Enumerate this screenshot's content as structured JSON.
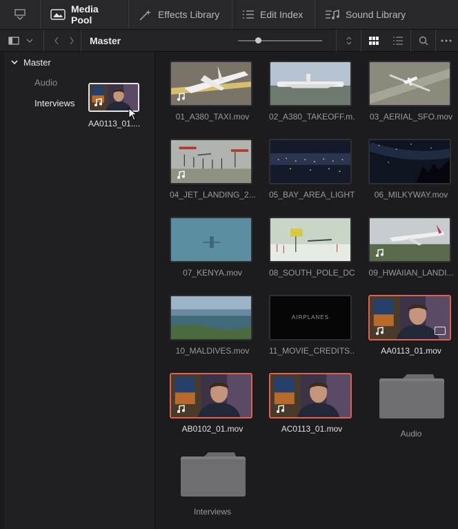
{
  "toolbar": {
    "media_pool": "Media Pool",
    "effects_library": "Effects Library",
    "edit_index": "Edit Index",
    "sound_library": "Sound Library"
  },
  "subbar": {
    "breadcrumb": "Master",
    "zoom_level": 0.24
  },
  "sidebar": {
    "root": "Master",
    "items": [
      {
        "label": "Audio"
      },
      {
        "label": "Interviews"
      }
    ],
    "drag_clip_label": "AA0113_01...."
  },
  "clips": [
    {
      "name": "01_A380_TAXI.mov",
      "audio": true
    },
    {
      "name": "02_A380_TAKEOFF.m...",
      "audio": false
    },
    {
      "name": "03_AERIAL_SFO.mov",
      "audio": false
    },
    {
      "name": "04_JET_LANDING_2....",
      "audio": true
    },
    {
      "name": "05_BAY_AREA_LIGHT...",
      "audio": false
    },
    {
      "name": "06_MILKYWAY.mov",
      "audio": false
    },
    {
      "name": "07_KENYA.mov",
      "audio": false
    },
    {
      "name": "08_SOUTH_POLE_DC...",
      "audio": false
    },
    {
      "name": "09_HWAIIAN_LANDI...",
      "audio": true
    },
    {
      "name": "10_MALDIVES.mov",
      "audio": false
    },
    {
      "name": "11_MOVIE_CREDITS....",
      "audio": false,
      "overlay_text": "AIRPLANES"
    },
    {
      "name": "AA0113_01.mov",
      "audio": true,
      "selected": true,
      "multicam": true
    },
    {
      "name": "AB0102_01.mov",
      "audio": true,
      "selected": true
    },
    {
      "name": "AC0113_01.mov",
      "audio": true,
      "selected": true
    }
  ],
  "folders": [
    {
      "name": "Audio"
    },
    {
      "name": "Interviews"
    }
  ],
  "colors": {
    "selection": "#e0624e",
    "panel": "#202023"
  }
}
